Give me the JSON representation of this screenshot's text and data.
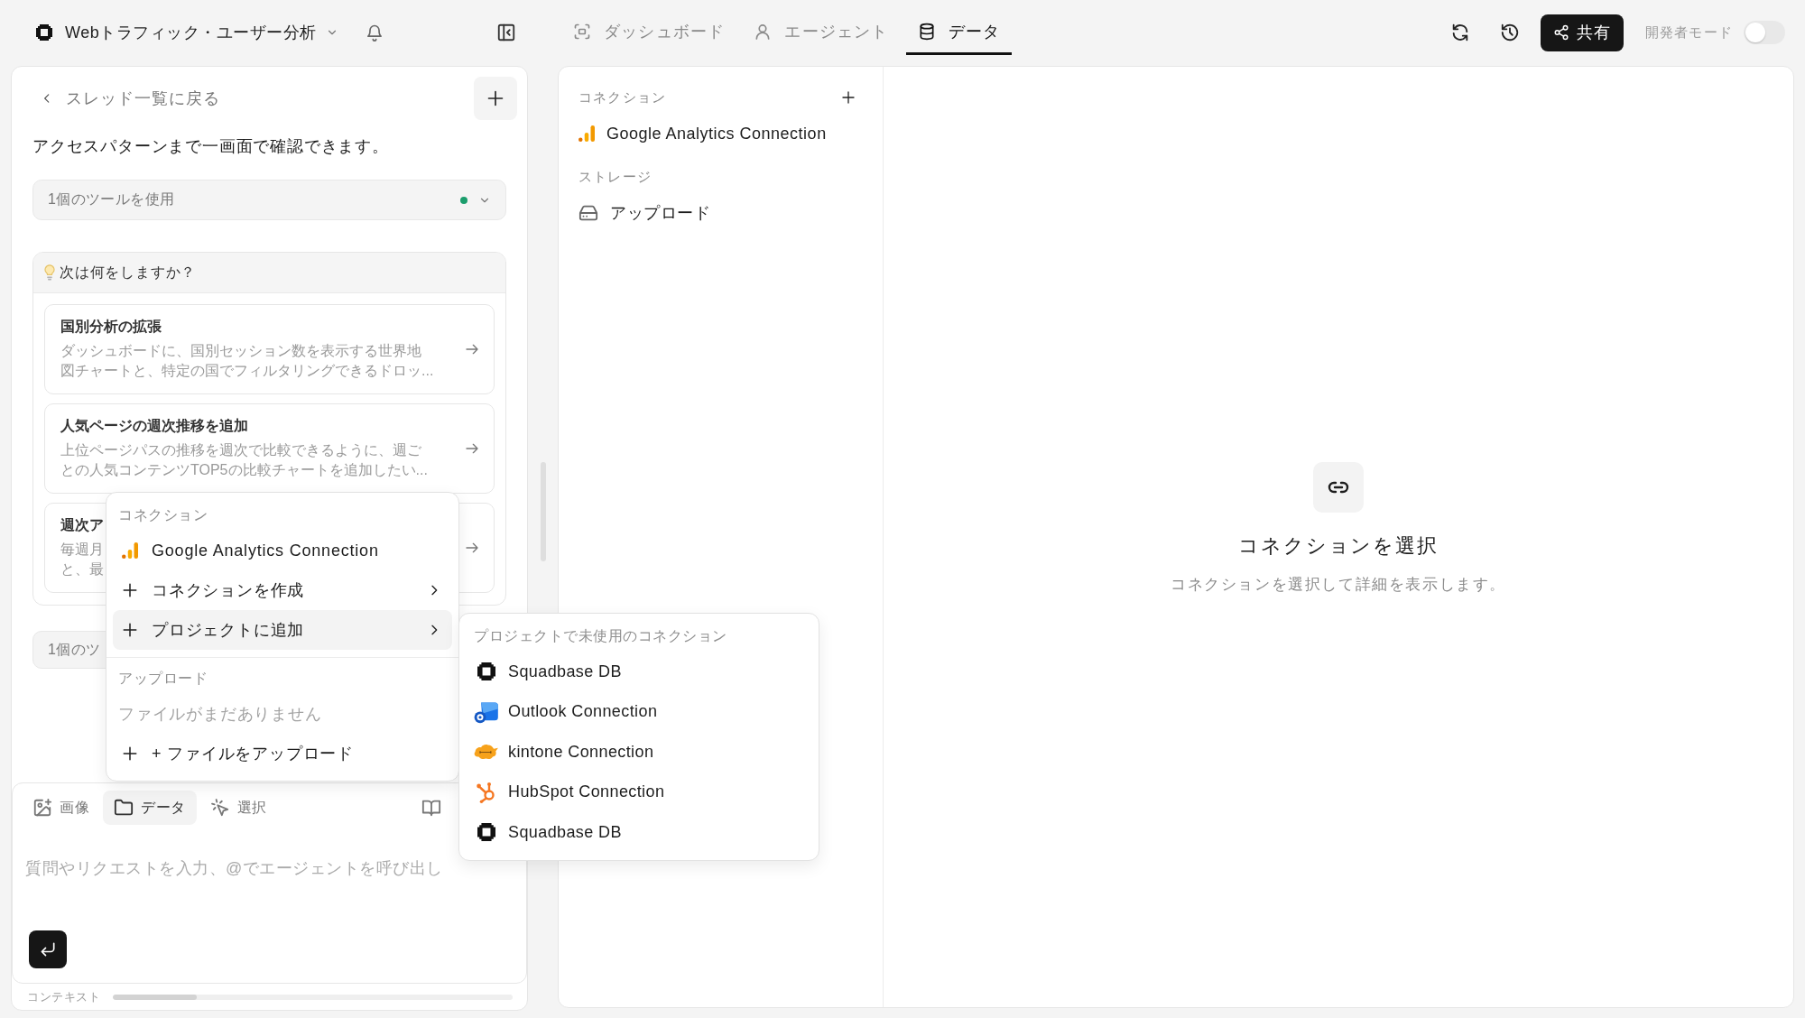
{
  "top_bar": {
    "project_title": "Webトラフィック・ユーザー分析",
    "tabs": [
      {
        "kind": "dashboard",
        "label": "ダッシュボード",
        "selected": false
      },
      {
        "kind": "agent",
        "label": "エージェント",
        "selected": false
      },
      {
        "kind": "data",
        "label": "データ",
        "selected": true
      }
    ],
    "share_button": "共有",
    "developer_mode": {
      "label": "開発者モード",
      "on": false
    }
  },
  "thread_panel": {
    "back_link": "スレッド一覧に戻る",
    "blocks": [
      {
        "kind": "text",
        "text": "アクセスパターンまで一画面で確認できます。"
      },
      {
        "kind": "tool_run",
        "label": "1個のツールを使用",
        "color": "#1b9d6c"
      },
      {
        "kind": "suggestions",
        "title": "次は何をしますか？",
        "items": [
          {
            "title": "国別分析の拡張",
            "description": "ダッシュボードに、国別セッション数を表示する世界地図チャートと、特定の国でフィルタリングできるドロッ..."
          },
          {
            "title": "人気ページの週次推移を追加",
            "description": "上位ページパスの推移を週次で比較できるように、週ごとの人気コンテンツTOP5の比較チャートを追加したい..."
          },
          {
            "title": "週次ア",
            "description_lines": [
              "毎週月",
              "と、最"
            ]
          }
        ]
      },
      {
        "kind": "tool_run",
        "label": "1個のツ"
      }
    ],
    "composer": {
      "tools": [
        {
          "kind": "image",
          "label": "画像",
          "selected": false
        },
        {
          "kind": "folder",
          "label": "データ",
          "selected": true
        },
        {
          "kind": "pointer",
          "label": "選択",
          "selected": false
        },
        {
          "kind": "book",
          "selected": false
        }
      ],
      "placeholder": "質問やリクエストを入力、@でエージェントを呼び出し"
    },
    "context": {
      "label": "コンテキスト",
      "level": 0.21
    }
  },
  "data_panel": {
    "sections": [
      {
        "title": "コネクション",
        "addable": true,
        "items": [
          {
            "kind": "bars",
            "label": "Google Analytics Connection"
          }
        ]
      },
      {
        "title": "ストレージ",
        "addable": false,
        "items": [
          {
            "kind": "drive",
            "label": "アップロード"
          }
        ]
      }
    ]
  },
  "detail": {
    "title": "コネクションを選択",
    "description": "コネクションを選択して詳細を表示します。"
  },
  "add_menu": {
    "sections": [
      {
        "title": "コネクション",
        "items": [
          {
            "kind": "bars",
            "label": "Google Analytics Connection",
            "selected": false
          },
          {
            "kind": "submenu",
            "label": "コネクションを作成",
            "selected": false
          },
          {
            "kind": "submenu",
            "label": "プロジェクトに追加",
            "selected": true
          }
        ]
      },
      {
        "title": "アップロード",
        "items": [
          {
            "kind": "note",
            "label": "ファイルがまだありません",
            "selected": false
          },
          {
            "kind": "action",
            "label": "+ ファイルをアップロード",
            "selected": false
          }
        ]
      }
    ]
  },
  "submenu": {
    "title": "プロジェクトで未使用のコネクション",
    "items": [
      {
        "kind": "ring",
        "label": "Squadbase DB"
      },
      {
        "kind": "mail",
        "label": "Outlook Connection"
      },
      {
        "kind": "cloud",
        "label": "kintone Connection"
      },
      {
        "kind": "sprocket",
        "label": "HubSpot Connection"
      },
      {
        "kind": "ring",
        "label": "Squadbase DB"
      }
    ]
  }
}
